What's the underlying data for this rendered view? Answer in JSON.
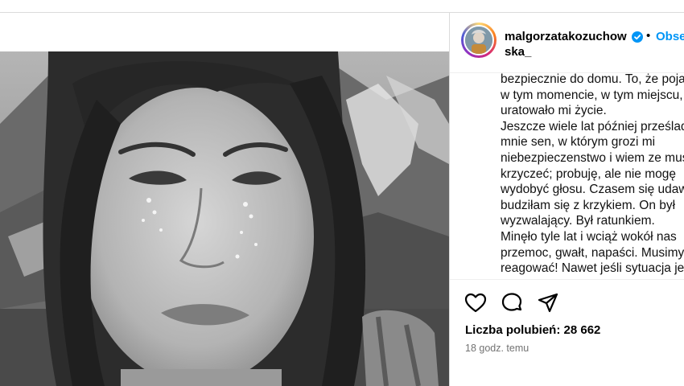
{
  "post": {
    "author": {
      "username": "malgorzatakozuchowska_",
      "verified": true,
      "follow_label": "Obserwuj",
      "separator": "•"
    },
    "caption_lines": [
      "bezpiecznie do domu. To, że pojawił się",
      "w tym momencie, w tym miejscu,",
      "uratowało mi życie.",
      "Jeszcze wiele lat później prześladował",
      "mnie sen, w którym grozi mi",
      "niebezpieczenstwo i wiem ze muszę",
      "krzyczeć; probuję, ale nie mogę",
      "wydobyć głosu. Czasem się udawało, i",
      "budziłam się z krzykiem. On był",
      "wyzwalający. Był ratunkiem.",
      "Minęło tyle lat i wciąż wokół nas",
      "przemoc, gwałt, napaści. Musimy",
      "reagować! Nawet jeśli sytuacja jest"
    ],
    "likes_text": "Liczba polubień: 28 662",
    "timestamp": "18 godz. temu"
  },
  "icons": {
    "like": "heart-icon",
    "comment": "comment-icon",
    "share": "share-icon",
    "verified": "verified-badge-icon"
  },
  "colors": {
    "accent": "#0095f6",
    "muted_text": "#737373",
    "border": "#dbdbdb"
  }
}
